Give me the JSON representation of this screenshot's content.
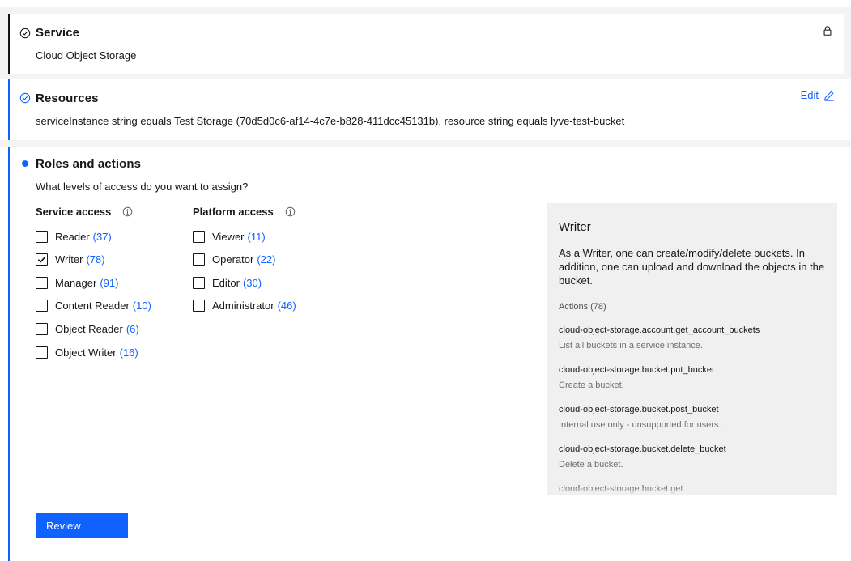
{
  "service": {
    "title": "Service",
    "value": "Cloud Object Storage"
  },
  "resources": {
    "title": "Resources",
    "value": "serviceInstance string equals Test Storage (70d5d0c6-af14-4c7e-b828-411dcc45131b), resource string equals lyve-test-bucket",
    "edit_label": "Edit"
  },
  "roles": {
    "title": "Roles and actions",
    "question": "What levels of access do you want to assign?",
    "service_access": {
      "heading": "Service access",
      "items": [
        {
          "label": "Reader",
          "count": "(37)",
          "checked": false
        },
        {
          "label": "Writer",
          "count": "(78)",
          "checked": true
        },
        {
          "label": "Manager",
          "count": "(91)",
          "checked": false
        },
        {
          "label": "Content Reader",
          "count": "(10)",
          "checked": false
        },
        {
          "label": "Object Reader",
          "count": "(6)",
          "checked": false
        },
        {
          "label": "Object Writer",
          "count": "(16)",
          "checked": false
        }
      ]
    },
    "platform_access": {
      "heading": "Platform access",
      "items": [
        {
          "label": "Viewer",
          "count": "(11)",
          "checked": false
        },
        {
          "label": "Operator",
          "count": "(22)",
          "checked": false
        },
        {
          "label": "Editor",
          "count": "(30)",
          "checked": false
        },
        {
          "label": "Administrator",
          "count": "(46)",
          "checked": false
        }
      ]
    }
  },
  "detail_panel": {
    "title": "Writer",
    "description": "As a Writer, one can create/modify/delete buckets. In addition, one can upload and download the objects in the bucket.",
    "actions_label": "Actions (78)",
    "actions": [
      {
        "name": "cloud-object-storage.account.get_account_buckets",
        "desc": "List all buckets in a service instance."
      },
      {
        "name": "cloud-object-storage.bucket.put_bucket",
        "desc": "Create a bucket."
      },
      {
        "name": "cloud-object-storage.bucket.post_bucket",
        "desc": "Internal use only - unsupported for users."
      },
      {
        "name": "cloud-object-storage.bucket.delete_bucket",
        "desc": "Delete a bucket."
      },
      {
        "name": "cloud-object-storage.bucket.get",
        "desc": ""
      }
    ]
  },
  "review_label": "Review",
  "colors": {
    "accent": "#0f62fe",
    "page_bg": "#f4f4f4",
    "panel_bg": "#f0f0f0",
    "service_bar": "#161616",
    "text": "#161616"
  },
  "icons": {
    "service_status": "checkmark-outline-icon",
    "resources_status": "checkmark-outline-icon",
    "roles_status": "filled-dot-icon",
    "lock": "lock-icon",
    "edit": "pencil-icon",
    "info": "information-icon"
  }
}
